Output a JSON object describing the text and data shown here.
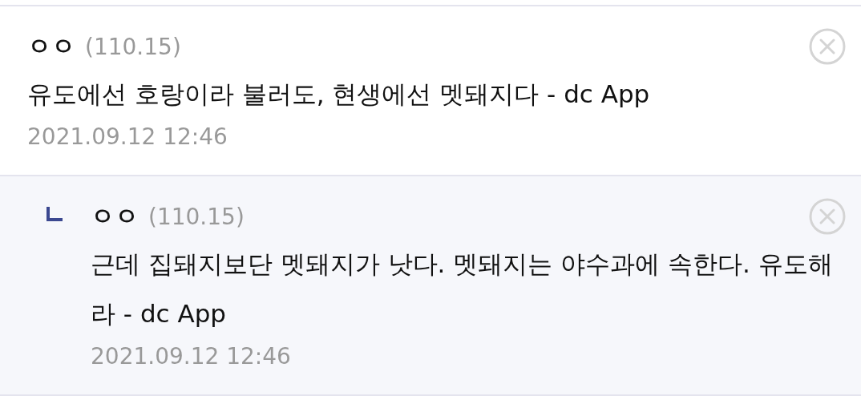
{
  "comments": [
    {
      "kind": "comment",
      "author": "ㅇㅇ",
      "ip": "(110.15)",
      "text": "유도에선 호랑이라 불러도, 현생에선 멧돼지다 - dc App",
      "date": "2021.09.12 12:46"
    },
    {
      "kind": "reply",
      "author": "ㅇㅇ",
      "ip": "(110.15)",
      "text": "근데 집돼지보단 멧돼지가 낫다. 멧돼지는 야수과에 속한다. 유도해라 - dc App",
      "date": "2021.09.12 12:46"
    }
  ]
}
